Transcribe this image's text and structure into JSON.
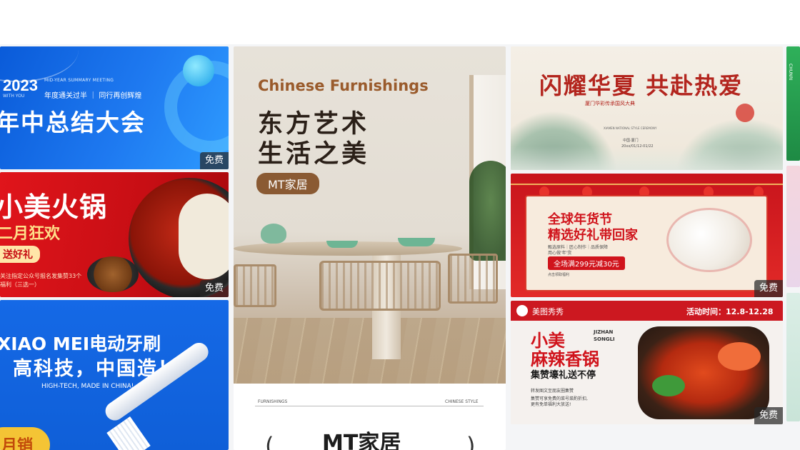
{
  "badge_free": "免费",
  "cards": {
    "meeting": {
      "year": "2023",
      "en_line1": "MID-YEAR SUMMARY MEETING",
      "en_line2": "WITH YOU",
      "subtitle": "年度通关过半 ｜ 同行再创辉煌",
      "title": "年中总结大会"
    },
    "hotpot": {
      "title": "小美火锅",
      "subtitle": "二月狂欢",
      "pill": "送好礼",
      "note1": "关注指定公众号报名发集赞33个",
      "note2": "福利（三选一）"
    },
    "toothbrush": {
      "title1": "XIAO MEI电动牙刷",
      "title2": "高科技，中国造！",
      "en": "HIGH-TECH, MADE IN CHINA!",
      "corner": "月销"
    },
    "furnishings": {
      "title_en": "Chinese Furnishings",
      "title_cn1": "东方艺术",
      "title_cn2": "生活之美",
      "tag": "MT家居",
      "small_left": "FURNISHINGS",
      "small_right": "CHINESE STYLE",
      "brand": "MT家居",
      "paren_left": "(",
      "paren_right": ")"
    },
    "landscape": {
      "title": "闪耀华夏 共赴热爱",
      "subtitle": "厦门华彩传承国风大典",
      "en": "XIAMEN NATIONAL STYLE CEREMONY",
      "date1": "中国·厦门",
      "date2": "20xx/01/12-01/22"
    },
    "newyear": {
      "title1": "全球年货节",
      "title2": "精选好礼带回家",
      "line1": "甄选原料｜匠心制作｜品质保障",
      "line2": "用心做'年'货",
      "button": "全场满299元减30元",
      "line3": "点击领取福利"
    },
    "spicypot": {
      "logo_text": "美图秀秀",
      "time": "活动时间：12.8-12.28",
      "title1": "小美",
      "title2": "麻辣香锅",
      "en1": "JIZHAN",
      "en2": "SONGLI",
      "offer": "集赞壕礼送不停",
      "desc1": "转发图文至朋友圈集赞",
      "desc2": "集赞可享免费的菜号菜酌折扣,",
      "desc3": "更有免单福利大放送!"
    },
    "sliver": {
      "text": "CHUNRI"
    }
  },
  "colors": {
    "meeting_blue": "#1e79f0",
    "hotpot_red": "#d0141c",
    "toothbrush_blue": "#1569e6",
    "furnishing_brown": "#8a5a33",
    "landscape_red": "#b3251e",
    "badge_bg": "#282828"
  }
}
